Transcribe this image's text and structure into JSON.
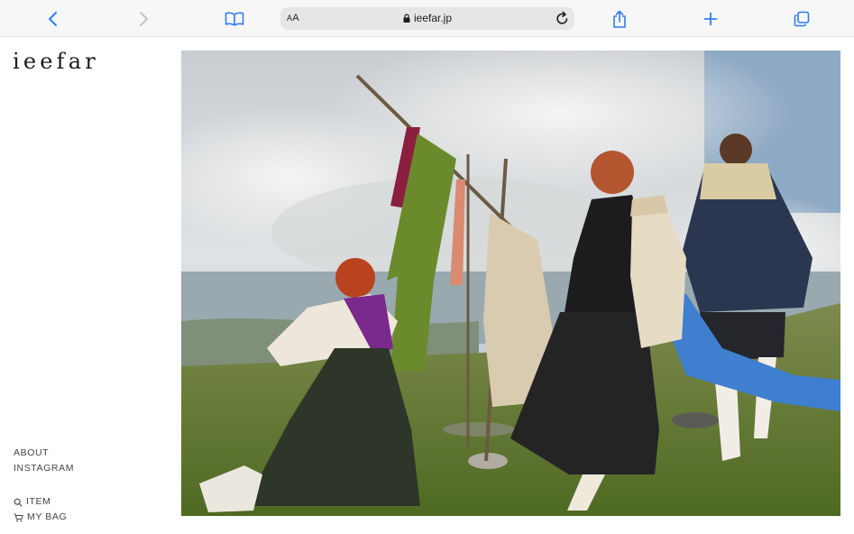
{
  "browser": {
    "reader_label_small": "A",
    "reader_label_large": "A",
    "url": "ieefar.jp",
    "icons": {
      "back": "chevron-left-icon",
      "forward": "chevron-right-icon",
      "bookmarks": "book-icon",
      "lock": "lock-icon",
      "reload": "reload-icon",
      "share": "share-icon",
      "new_tab": "plus-icon",
      "tabs": "tabs-icon"
    },
    "accent": "#2f7cf6"
  },
  "site": {
    "logo": "ieefar",
    "nav": {
      "about": "ABOUT",
      "instagram": "INSTAGRAM",
      "item": "ITEM",
      "bag": "MY BAG"
    }
  }
}
